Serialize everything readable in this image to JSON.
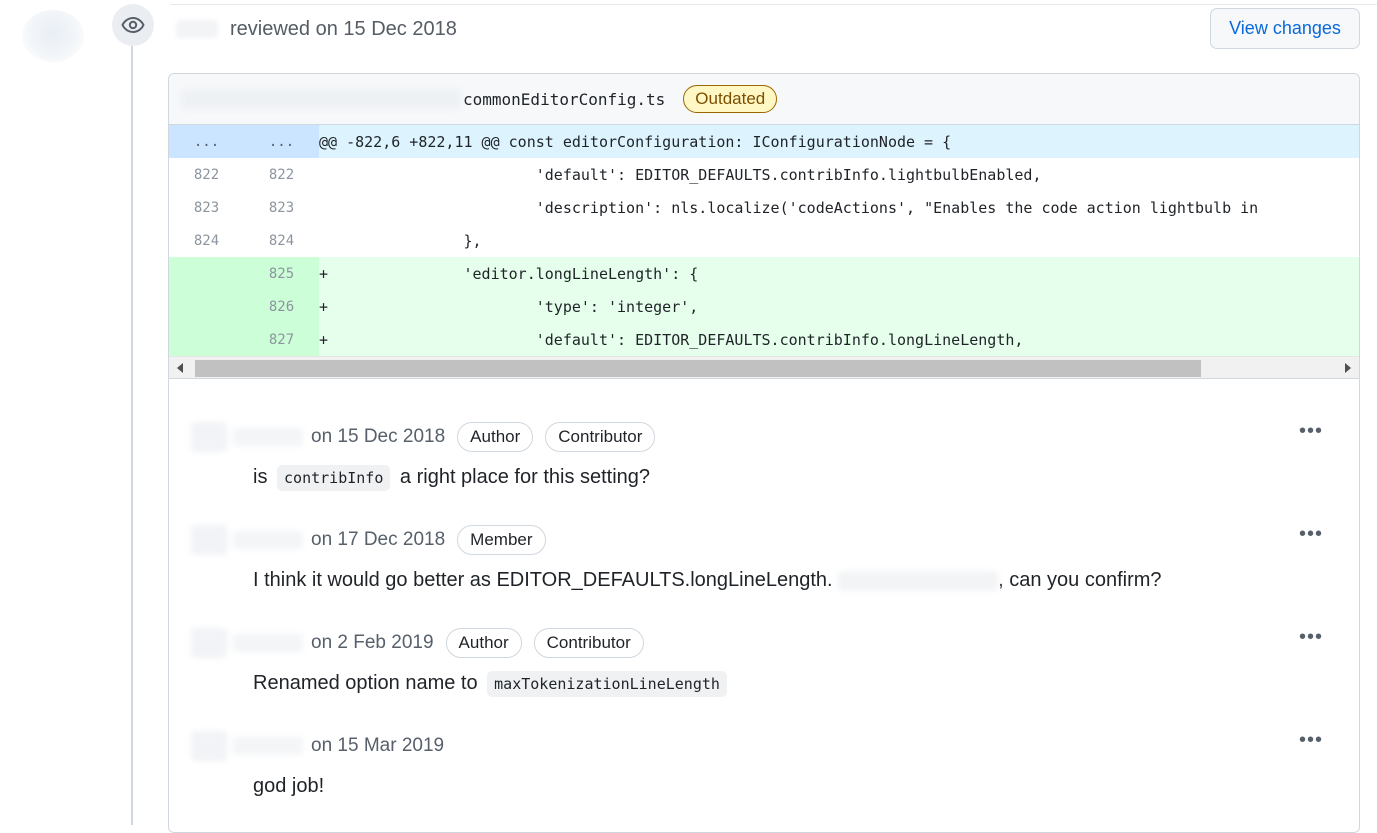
{
  "review": {
    "text": "reviewed on 15 Dec 2018",
    "view_changes": "View changes"
  },
  "file": {
    "name": "commonEditorConfig.ts",
    "status": "Outdated"
  },
  "diff": {
    "hunk": {
      "left": "...",
      "right": "...",
      "text": "@@ -822,6 +822,11 @@ const editorConfiguration: IConfigurationNode = {"
    },
    "lines": [
      {
        "old": "822",
        "new": "822",
        "sign": "",
        "code": "\t\t\t'default': EDITOR_DEFAULTS.contribInfo.lightbulbEnabled,",
        "type": "context"
      },
      {
        "old": "823",
        "new": "823",
        "sign": "",
        "code": "\t\t\t'description': nls.localize('codeActions', \"Enables the code action lightbulb in",
        "type": "context"
      },
      {
        "old": "824",
        "new": "824",
        "sign": "",
        "code": "\t\t},",
        "type": "context"
      },
      {
        "old": "",
        "new": "825",
        "sign": "+",
        "code": "\t\t'editor.longLineLength': {",
        "type": "add"
      },
      {
        "old": "",
        "new": "826",
        "sign": "+",
        "code": "\t\t\t'type': 'integer',",
        "type": "add"
      },
      {
        "old": "",
        "new": "827",
        "sign": "+",
        "code": "\t\t\t'default': EDITOR_DEFAULTS.contribInfo.longLineLength,",
        "type": "add"
      }
    ]
  },
  "comments": [
    {
      "date": "on 15 Dec 2018",
      "badges": [
        "Author",
        "Contributor"
      ],
      "body_before": "is",
      "code": "contribInfo",
      "body_after": "a right place for this setting?"
    },
    {
      "date": "on 17 Dec 2018",
      "badges": [
        "Member"
      ],
      "body_before": "I think it would go better as EDITOR_DEFAULTS.longLineLength.",
      "body_after": ", can you confirm?"
    },
    {
      "date": "on 2 Feb 2019",
      "badges": [
        "Author",
        "Contributor"
      ],
      "body_before": "Renamed option name to",
      "code": "maxTokenizationLineLength"
    },
    {
      "date": "on 15 Mar 2019",
      "badges": [],
      "body_before": "god job!"
    }
  ],
  "icons": {
    "eye": "eye-icon",
    "more": "kebab-horizontal-icon"
  },
  "more_label": "•••"
}
